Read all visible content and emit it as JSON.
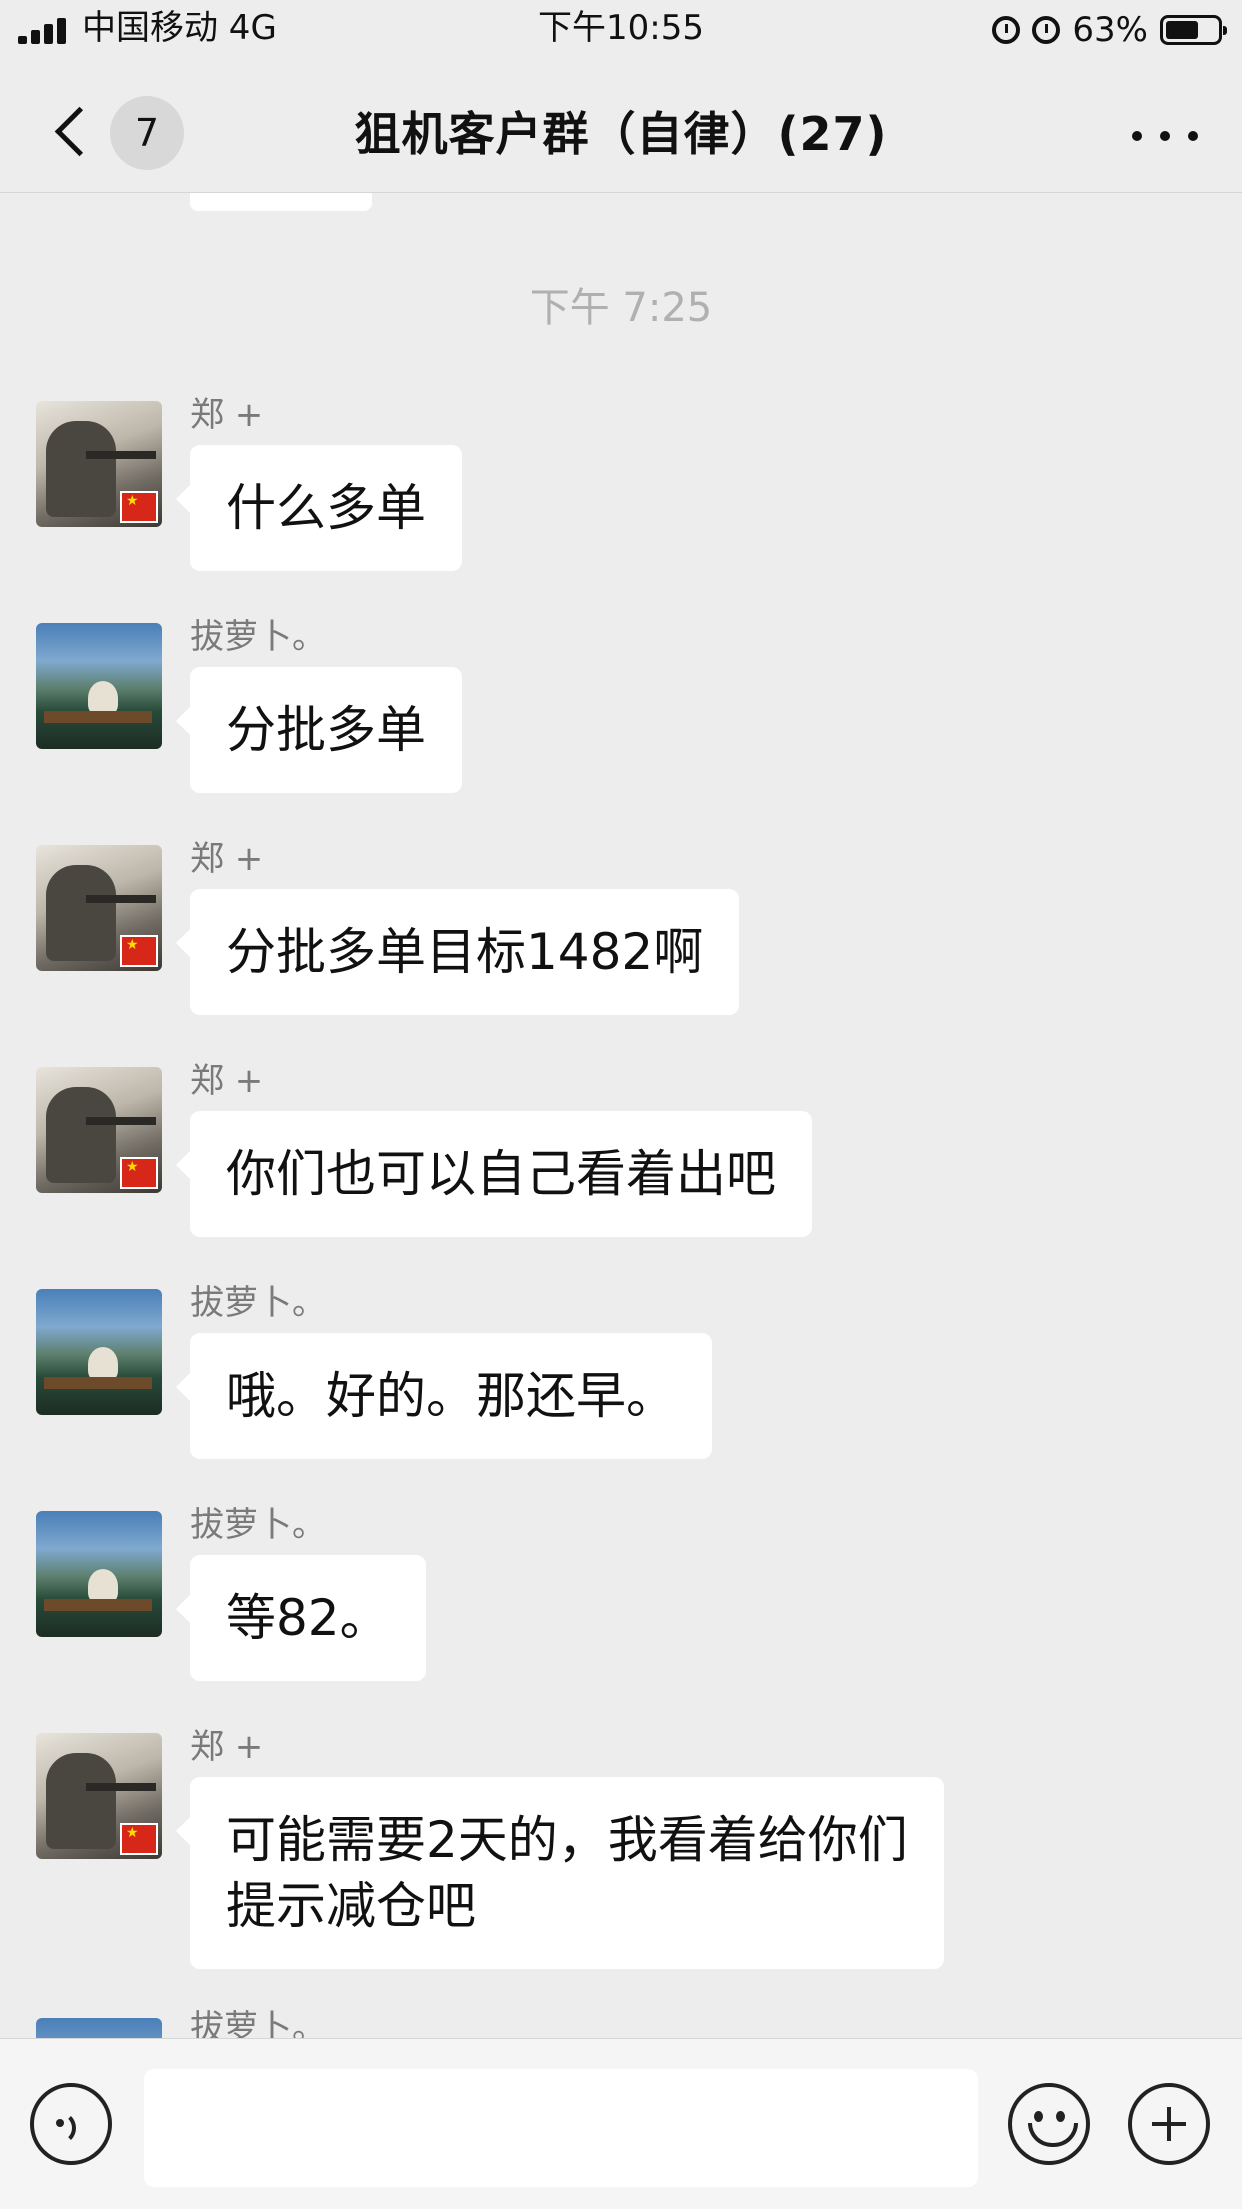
{
  "status_bar": {
    "carrier": "中国移动 4G",
    "time": "下午10:55",
    "battery_percent": "63%",
    "battery_level": 0.63,
    "icons": [
      "signal-icon",
      "alarm-icon",
      "rotation-lock-icon",
      "battery-icon"
    ]
  },
  "nav": {
    "unread_count": "7",
    "title": "狙机客户群（自律）(27)",
    "icons": [
      "back-chevron-icon",
      "more-icon"
    ]
  },
  "chat": {
    "timestamp": "下午 7:25",
    "messages": [
      {
        "sender": "郑 +",
        "text": "什么多单",
        "avatar": "soldier-avatar"
      },
      {
        "sender": "拔萝卜。",
        "text": "分批多单",
        "avatar": "lake-avatar"
      },
      {
        "sender": "郑 +",
        "text": "分批多单目标1482啊",
        "avatar": "soldier-avatar"
      },
      {
        "sender": "郑 +",
        "text": "你们也可以自己看着出吧",
        "avatar": "soldier-avatar"
      },
      {
        "sender": "拔萝卜。",
        "text": "哦。好的。那还早。",
        "avatar": "lake-avatar"
      },
      {
        "sender": "拔萝卜。",
        "text": "等82。",
        "avatar": "lake-avatar"
      },
      {
        "sender": "郑 +",
        "text_line1": "可能需要2天的，我看着给你们",
        "text_line2": "提示减仓吧",
        "avatar": "soldier-avatar"
      }
    ],
    "partial_sender": "拔萝卜。"
  },
  "input_bar": {
    "icons": [
      "voice-icon",
      "emoji-icon",
      "plus-icon"
    ],
    "value": ""
  }
}
